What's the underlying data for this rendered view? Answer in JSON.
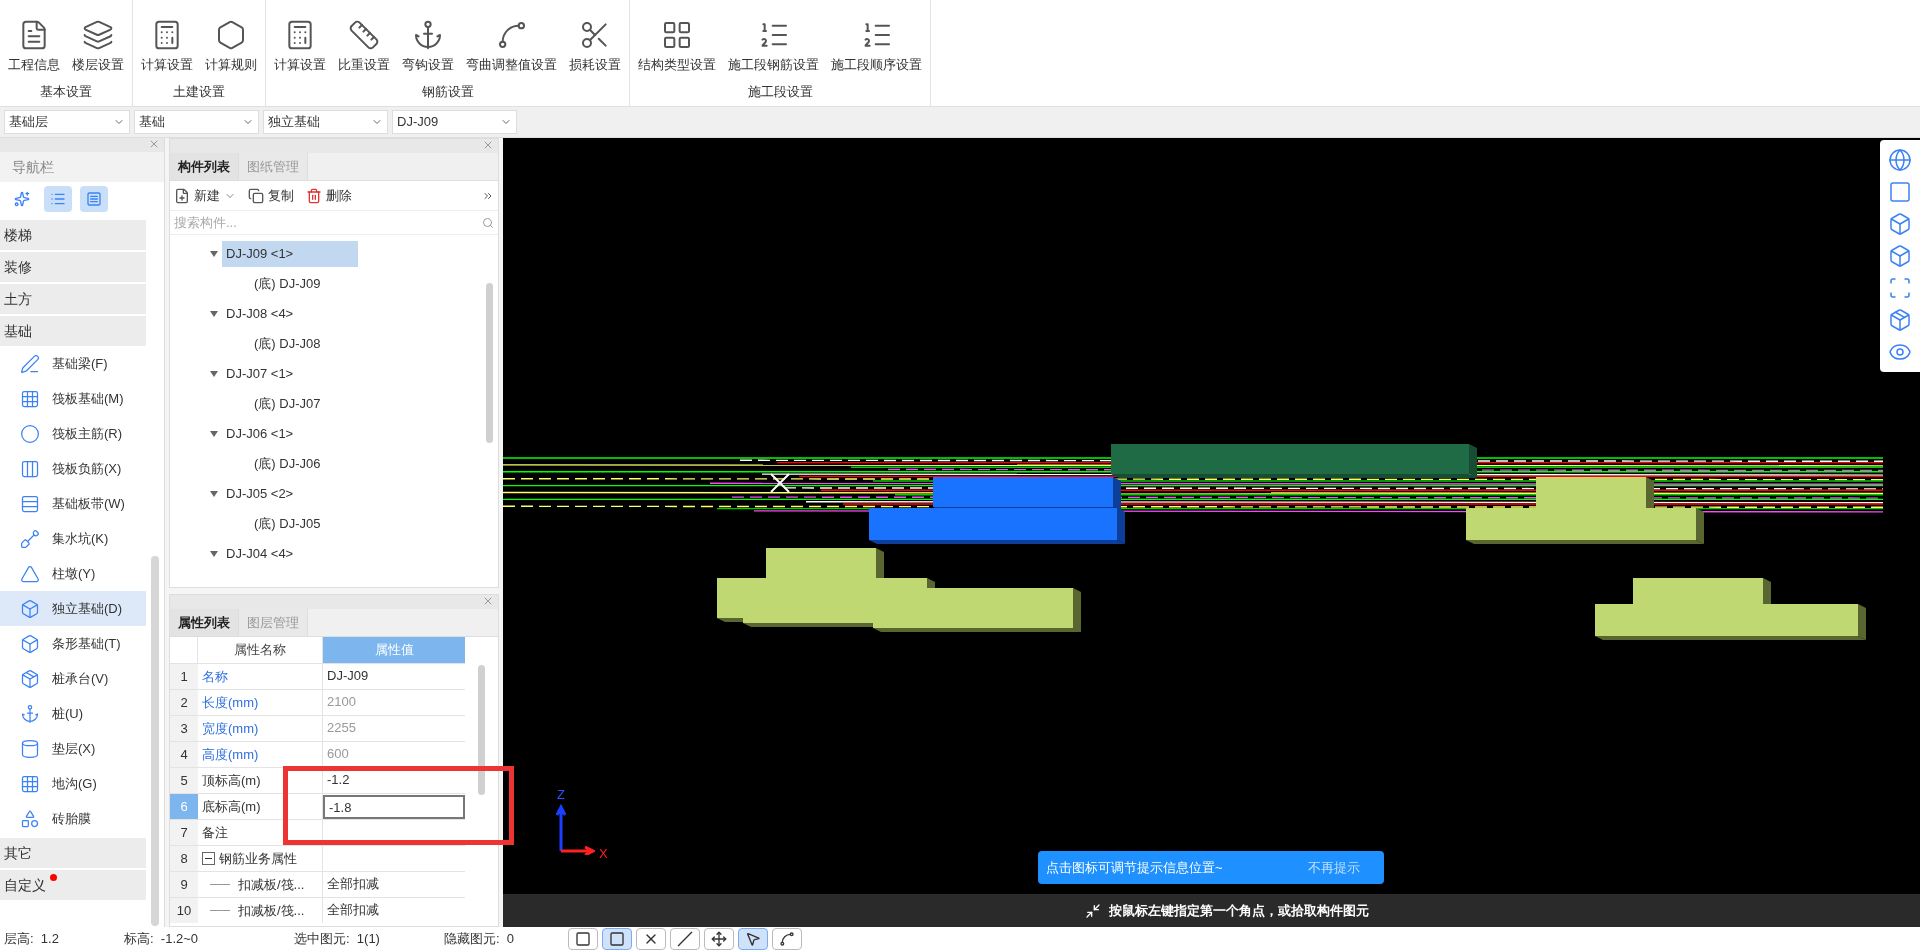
{
  "ribbon": {
    "groups": [
      {
        "label": "基本设置",
        "buttons": [
          "工程信息",
          "楼层设置"
        ]
      },
      {
        "label": "土建设置",
        "buttons": [
          "计算设置",
          "计算规则"
        ]
      },
      {
        "label": "钢筋设置",
        "buttons": [
          "计算设置",
          "比重设置",
          "弯钩设置",
          "弯曲调整值设置",
          "损耗设置"
        ]
      },
      {
        "label": "施工段设置",
        "buttons": [
          "结构类型设置",
          "施工段钢筋设置",
          "施工段顺序设置"
        ]
      }
    ]
  },
  "selectors": [
    "基础层",
    "基础",
    "独立基础",
    "DJ-J09"
  ],
  "nav": {
    "title": "导航栏",
    "view_buttons": [
      {
        "selected": false
      },
      {
        "selected": true
      },
      {
        "selected": true
      }
    ],
    "categories": [
      {
        "label": "楼梯",
        "badge": false
      },
      {
        "label": "装修",
        "badge": false
      },
      {
        "label": "土方",
        "badge": false
      },
      {
        "label": "基础",
        "badge": false,
        "items": [
          {
            "label": "基础梁(F)",
            "selected": false
          },
          {
            "label": "筏板基础(M)",
            "selected": false
          },
          {
            "label": "筏板主筋(R)",
            "selected": false
          },
          {
            "label": "筏板负筋(X)",
            "selected": false
          },
          {
            "label": "基础板带(W)",
            "selected": false
          },
          {
            "label": "集水坑(K)",
            "selected": false
          },
          {
            "label": "柱墩(Y)",
            "selected": false
          },
          {
            "label": "独立基础(D)",
            "selected": true
          },
          {
            "label": "条形基础(T)",
            "selected": false
          },
          {
            "label": "桩承台(V)",
            "selected": false
          },
          {
            "label": "桩(U)",
            "selected": false
          },
          {
            "label": "垫层(X)",
            "selected": false
          },
          {
            "label": "地沟(G)",
            "selected": false
          },
          {
            "label": "砖胎膜",
            "selected": false
          }
        ]
      },
      {
        "label": "其它",
        "badge": false
      },
      {
        "label": "自定义",
        "badge": true
      }
    ]
  },
  "component_panel": {
    "tabs": [
      {
        "label": "构件列表",
        "selected": true
      },
      {
        "label": "图纸管理",
        "selected": false
      }
    ],
    "toolbar": [
      "新建",
      "复制",
      "删除"
    ],
    "search": {
      "placeholder": "搜索构件..."
    },
    "tree": [
      {
        "label": "DJ-J09 <1>",
        "selected": true,
        "expanded": true,
        "children": [
          {
            "label": "(底) DJ-J09"
          }
        ]
      },
      {
        "label": "DJ-J08 <4>",
        "selected": false,
        "expanded": true,
        "children": [
          {
            "label": "(底) DJ-J08"
          }
        ]
      },
      {
        "label": "DJ-J07 <1>",
        "selected": false,
        "expanded": true,
        "children": [
          {
            "label": "(底) DJ-J07"
          }
        ]
      },
      {
        "label": "DJ-J06 <1>",
        "selected": false,
        "expanded": true,
        "children": [
          {
            "label": "(底) DJ-J06"
          }
        ]
      },
      {
        "label": "DJ-J05 <2>",
        "selected": false,
        "expanded": true,
        "children": [
          {
            "label": "(底) DJ-J05"
          }
        ]
      },
      {
        "label": "DJ-J04 <4>",
        "selected": false,
        "expanded": true
      }
    ]
  },
  "property_panel": {
    "tabs": [
      {
        "label": "属性列表",
        "selected": true
      },
      {
        "label": "图层管理",
        "selected": false
      }
    ],
    "columns": [
      "属性名称",
      "属性值"
    ],
    "rows": [
      {
        "index": "1",
        "name": "名称",
        "value": "DJ-J09",
        "public": true,
        "readonly": false,
        "selected": false,
        "kind": "plain"
      },
      {
        "index": "2",
        "name": "长度(mm)",
        "value": "2100",
        "public": true,
        "readonly": true,
        "selected": false,
        "kind": "plain"
      },
      {
        "index": "3",
        "name": "宽度(mm)",
        "value": "2255",
        "public": true,
        "readonly": true,
        "selected": false,
        "kind": "plain"
      },
      {
        "index": "4",
        "name": "高度(mm)",
        "value": "600",
        "public": true,
        "readonly": true,
        "selected": false,
        "kind": "plain"
      },
      {
        "index": "5",
        "name": "顶标高(m)",
        "value": "-1.2",
        "public": false,
        "readonly": false,
        "selected": false,
        "kind": "plain"
      },
      {
        "index": "6",
        "name": "底标高(m)",
        "value": "-1.8",
        "public": false,
        "readonly": false,
        "selected": true,
        "kind": "plain"
      },
      {
        "index": "7",
        "name": "备注",
        "public": false,
        "selected": false,
        "kind": "plain"
      },
      {
        "index": "8",
        "name": "钢筋业务属性",
        "public": false,
        "selected": false,
        "kind": "group",
        "expanded": true
      },
      {
        "index": "9",
        "name": "扣减板/筏...",
        "value": "全部扣减",
        "public": false,
        "readonly": false,
        "selected": false,
        "kind": "child"
      },
      {
        "index": "10",
        "name": "扣减板/筏...",
        "value": "全部扣减",
        "public": false,
        "readonly": false,
        "selected": false,
        "kind": "child"
      }
    ]
  },
  "viewport": {
    "axis_labels": [
      "Z",
      "X"
    ],
    "tip": {
      "text": "点击图标可调节提示信息位置~",
      "action": "不再提示"
    },
    "hint": "按鼠标左键指定第一个角点，或拾取构件图元"
  },
  "status_bar": [
    {
      "label": "层高:",
      "value": "1.2"
    },
    {
      "label": "标高:",
      "value": "-1.2~0"
    },
    {
      "label": "选中图元:",
      "value": "1(1)"
    },
    {
      "label": "隐藏图元:",
      "value": "0"
    }
  ],
  "status_tools": [
    {
      "selected": false
    },
    {
      "selected": true
    },
    {
      "selected": false
    },
    {
      "selected": false
    },
    {
      "selected": false
    },
    {
      "selected": true
    },
    {
      "selected": false
    }
  ]
}
